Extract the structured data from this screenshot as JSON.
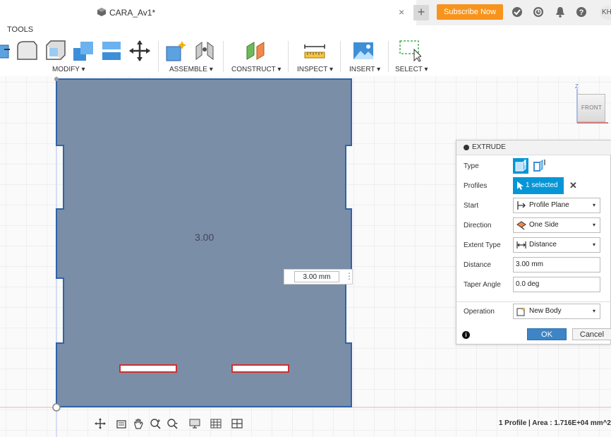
{
  "tab": {
    "title": "CARA_Av1*",
    "close_glyph": "×",
    "new_glyph": "+"
  },
  "header": {
    "subscribe_label": "Subscribe Now",
    "user_initials": "KH"
  },
  "toolbar": {
    "tools_label": "TOOLS",
    "groups": [
      {
        "label": "MODIFY ▾"
      },
      {
        "label": "ASSEMBLE ▾"
      },
      {
        "label": "CONSTRUCT ▾"
      },
      {
        "label": "INSPECT ▾"
      },
      {
        "label": "INSERT ▾"
      },
      {
        "label": "SELECT ▾"
      }
    ]
  },
  "canvas": {
    "dimension_label": "3.00",
    "dimension_input_value": "3.00 mm",
    "menu_glyph": "⋮",
    "viewcube_face": "FRONT",
    "axis_label": "Z"
  },
  "extrude": {
    "title": "EXTRUDE",
    "rows": {
      "type": "Type",
      "profiles": "Profiles",
      "start": "Start",
      "direction": "Direction",
      "extent_type": "Extent Type",
      "distance": "Distance",
      "taper_angle": "Taper Angle",
      "operation": "Operation"
    },
    "values": {
      "profiles_selected": "1 selected",
      "clear_glyph": "✕",
      "start": "Profile Plane",
      "direction": "One Side",
      "extent_type": "Distance",
      "distance": "3.00 mm",
      "taper_angle": "0.0 deg",
      "operation": "New Body"
    },
    "dropdown_caret": "▾",
    "info_glyph": "i",
    "ok_label": "OK",
    "cancel_label": "Cancel"
  },
  "status": {
    "text": "1 Profile | Area : 1.716E+04 mm^2"
  },
  "colors": {
    "accent": "#0696d7",
    "subscribe": "#f7941d",
    "body": "#7b8ea8",
    "edge": "#2f64a8"
  }
}
